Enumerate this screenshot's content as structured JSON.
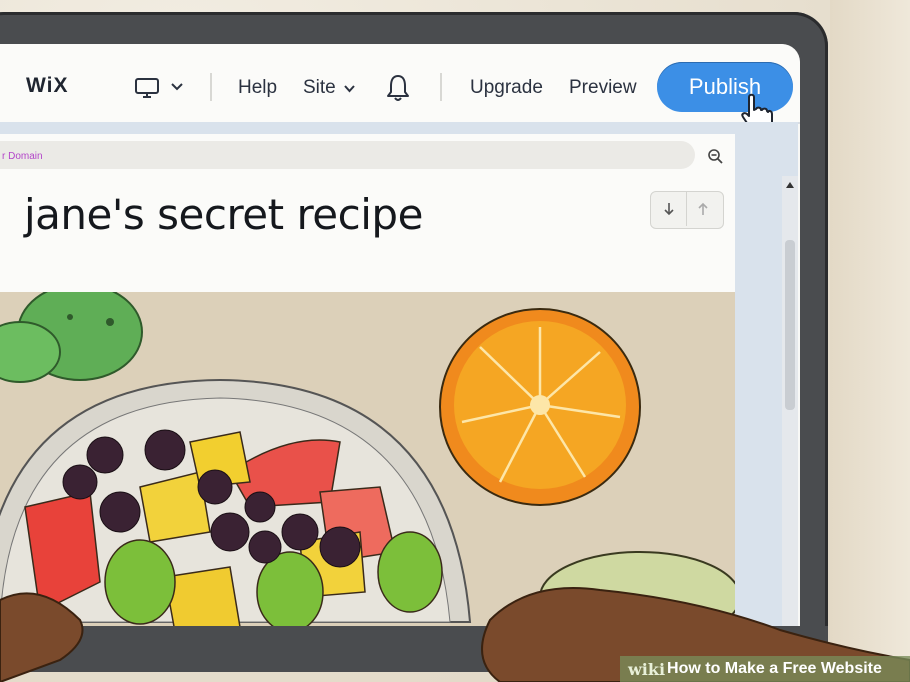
{
  "toolbar": {
    "logo": "WiX",
    "help_label": "Help",
    "site_label": "Site",
    "upgrade_label": "Upgrade",
    "preview_label": "Preview",
    "publish_label": "Publish"
  },
  "editor": {
    "url_text": "r Domain",
    "site_title": "jane's secret recipe"
  },
  "icons": [
    "desktop-icon",
    "chevron-down-icon",
    "bell-icon",
    "zoom-out-icon",
    "arrow-down-icon",
    "arrow-up-icon",
    "hand-cursor-icon"
  ],
  "colors": {
    "publish_button": "#3c8fe6",
    "url_text": "#b345c9",
    "laptop_frame": "#4a4c4f"
  },
  "watermark": {
    "brand": "wiki",
    "text": "How to Make a Free Website"
  }
}
